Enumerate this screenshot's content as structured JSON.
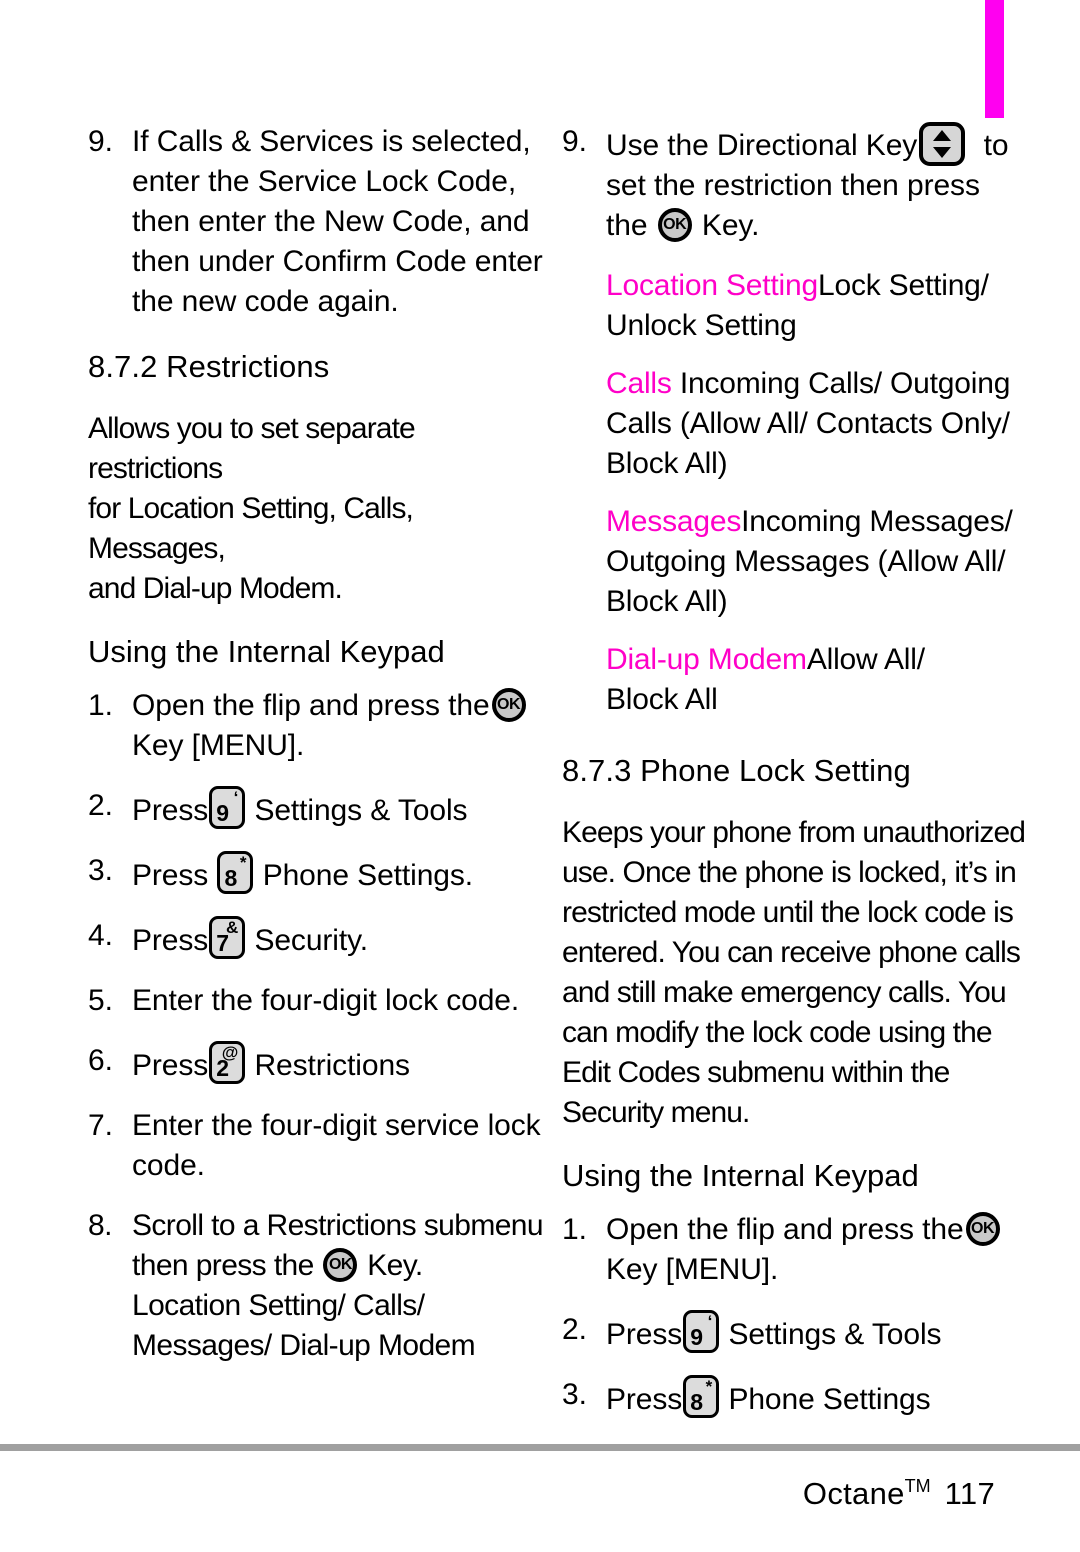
{
  "page": {
    "thumb_tab_color": "#ff00f0",
    "accent_color": "#ff00c8",
    "footer": {
      "product": "Octane",
      "trademark": "TM",
      "page_number": "117"
    }
  },
  "left_column": {
    "step9": {
      "num": "9.",
      "line1": "If Calls & Services is selected,",
      "line2": "enter the Service Lock Code,",
      "line3": "then enter the New Code, and",
      "line4": "then under Confirm Code enter",
      "line5": "the new code again."
    },
    "section_872": {
      "heading": "8.7.2 Restrictions",
      "body_line1": "Allows you to set separate restrictions",
      "body_line2": "for Location Setting, Calls, Messages,",
      "body_line3": "and Dial-up Modem.",
      "subheading": "Using the Internal Keypad"
    },
    "steps": [
      {
        "num": "1.",
        "text_before": "Open the flip and press the",
        "icon": "ok-key-icon",
        "text_after": "",
        "line2": "Key [MENU]."
      },
      {
        "num": "2.",
        "text_before": "Press",
        "icon": "keypad-9-icon",
        "key_num": "9",
        "key_sym": "‘",
        "text_after": "Settings & Tools"
      },
      {
        "num": "3.",
        "text_before": "Press",
        "icon": "keypad-8-icon",
        "key_num": "8",
        "key_sym": "*",
        "text_after": "Phone Settings."
      },
      {
        "num": "4.",
        "text_before": "Press",
        "icon": "keypad-7-icon",
        "key_num": "7",
        "key_sym": "&",
        "text_after": "Security."
      },
      {
        "num": "5.",
        "text_before": "Enter the four-digit lock code.",
        "icon": "",
        "text_after": ""
      },
      {
        "num": "6.",
        "text_before": "Press",
        "icon": "keypad-2-icon",
        "key_num": "2",
        "key_sym": "@",
        "text_after": "Restrictions"
      },
      {
        "num": "7.",
        "text_before": "Enter the four-digit service lock",
        "icon": "",
        "text_after": "",
        "line2": "code."
      },
      {
        "num": "8.",
        "text_before": "Scroll to a Restrictions submenu",
        "icon": "",
        "text_after": "",
        "line2_before": "then press the",
        "line2_icon": "ok-key-icon",
        "line2_after": "Key.",
        "line3": "Location Setting/ Calls/",
        "line4": "Messages/ Dial-up Modem"
      }
    ]
  },
  "right_column": {
    "step9": {
      "num": "9.",
      "text_before": "Use the Directional Key",
      "icon": "directional-key-icon",
      "text_after": "to",
      "line2": "set the restriction then press",
      "line3_before": "the",
      "line3_icon": "ok-key-icon",
      "line3_after": "Key."
    },
    "options": [
      {
        "key": "Location Setting",
        "value_line1": "Lock Setting/",
        "value_line2": "Unlock Setting"
      },
      {
        "key": "Calls",
        "value_line1": " Incoming Calls/ Outgoing",
        "value_line2": "Calls (Allow All/ Contacts Only/",
        "value_line3": "Block All)"
      },
      {
        "key": "Messages",
        "value_line1": "Incoming Messages/",
        "value_line2": "Outgoing Messages (Allow All/",
        "value_line3": "Block All)"
      },
      {
        "key": "Dial-up Modem",
        "value_line1": "Allow All/",
        "value_line2": "Block All"
      }
    ],
    "section_873": {
      "heading": "8.7.3 Phone Lock Setting",
      "body_line1": "Keeps your phone from unauthorized",
      "body_line2": "use. Once the phone is locked, it’s in",
      "body_line3": "restricted mode until the lock code is",
      "body_line4": "entered. You can receive phone calls",
      "body_line5": "and still make emergency calls. You",
      "body_line6": "can modify the lock code using the",
      "body_line7": "Edit Codes submenu within the",
      "body_line8": "Security menu.",
      "subheading": "Using the Internal Keypad"
    },
    "steps": [
      {
        "num": "1.",
        "text_before": "Open the flip and press the",
        "icon": "ok-key-icon",
        "text_after": "",
        "line2": "Key [MENU]."
      },
      {
        "num": "2.",
        "text_before": "Press",
        "icon": "keypad-9-icon",
        "key_num": "9",
        "key_sym": "‘",
        "text_after": "Settings & Tools"
      },
      {
        "num": "3.",
        "text_before": "Press",
        "icon": "keypad-8-icon",
        "key_num": "8",
        "key_sym": "*",
        "text_after": "Phone Settings"
      }
    ]
  }
}
